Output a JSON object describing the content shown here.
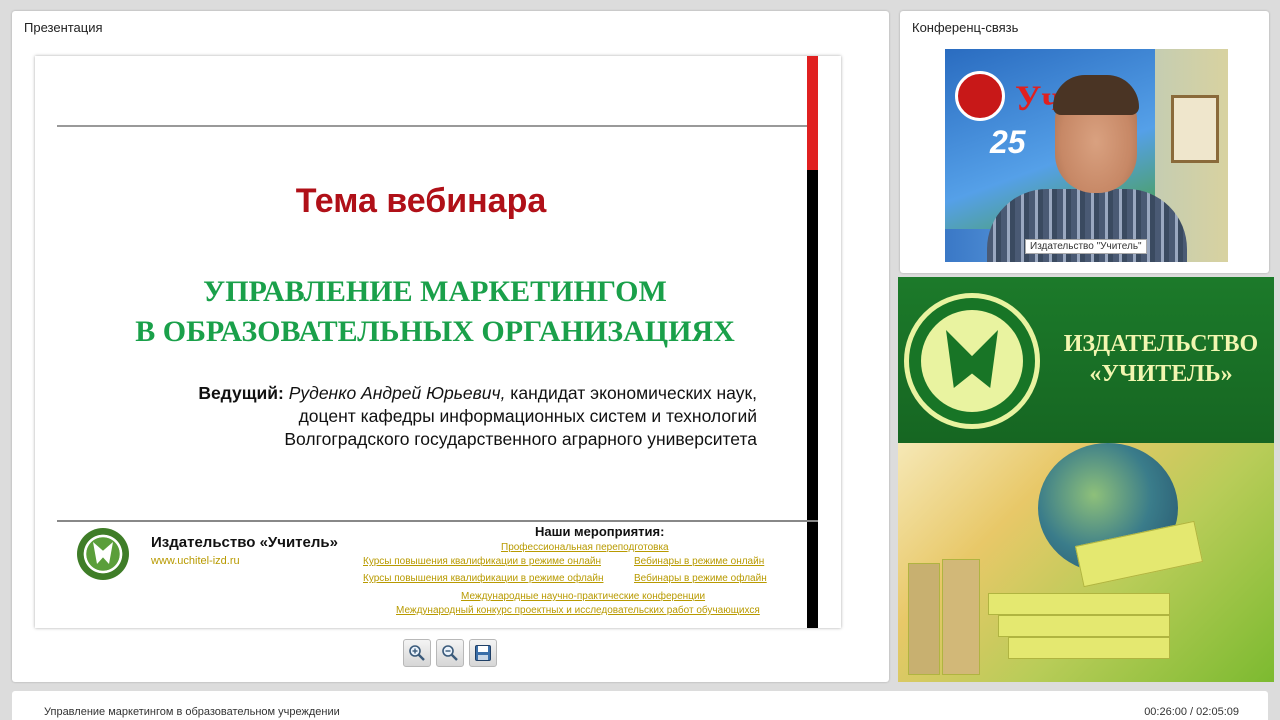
{
  "presentation": {
    "panel_title": "Презентация",
    "slide": {
      "title": "Тема вебинара",
      "subtitle_line1": "УПРАВЛЕНИЕ МАРКЕТИНГОМ",
      "subtitle_line2": "В ОБРАЗОВАТЕЛЬНЫХ ОРГАНИЗАЦИЯХ",
      "host_label": "Ведущий:",
      "host_name": "Руденко Андрей Юрьевич,",
      "host_line1_rest": " кандидат экономических наук,",
      "host_line2": "доцент кафедры информационных систем и технологий",
      "host_line3": "Волгоградского государственного аграрного университета",
      "publisher_name": "Издательство «Учитель»",
      "publisher_url": "www.uchitel-izd.ru",
      "events_title": "Наши мероприятия:",
      "events": [
        "Профессиональная переподготовка",
        "Курсы повышения квалификации в режиме онлайн",
        "Вебинары в режиме онлайн",
        "Курсы повышения квалификации в режиме офлайн",
        "Вебинары в режиме офлайн",
        "Международные научно-практические конференции",
        "Международный конкурс проектных и исследовательских работ обучающихся"
      ]
    },
    "toolbar": {
      "zoom_in_icon": "zoom-in-icon",
      "zoom_out_icon": "zoom-out-icon",
      "save_icon": "floppy-disk-icon"
    }
  },
  "conference": {
    "panel_title": "Конференц-связь",
    "video_caption": "Издательство \"Учитель\"",
    "background_sign": "Учи",
    "background_number": "25"
  },
  "banner": {
    "line1": "ИЗДАТЕЛЬСТВО",
    "line2": "«УЧИТЕЛЬ»"
  },
  "footer": {
    "title": "Управление маркетингом в образовательном учреждении",
    "time": "00:26:00 / 02:05:09"
  },
  "colors": {
    "slide_title": "#b01018",
    "slide_subtitle": "#1aa04a",
    "banner_green": "#1c7a2a",
    "link_gold": "#b89a00"
  }
}
